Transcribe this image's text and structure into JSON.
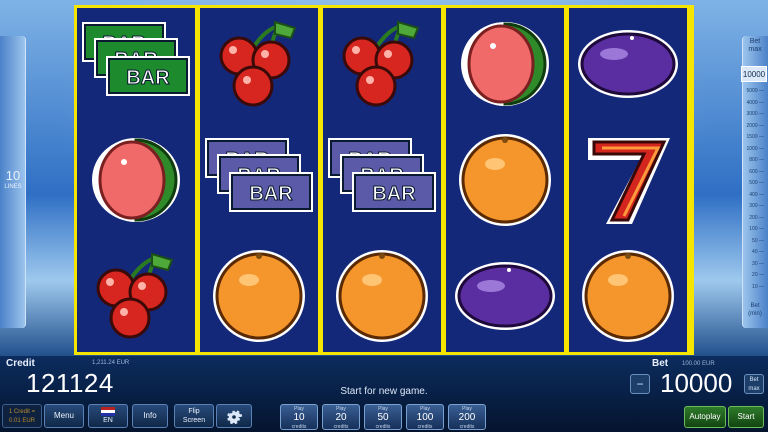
{
  "lines": {
    "value": "10",
    "label": "LINES"
  },
  "bet_scale": {
    "top_label": "Bet",
    "top_max": "max",
    "current": "10000",
    "ticks": [
      "5000",
      "4000",
      "3000",
      "2000",
      "1500",
      "1000",
      "800",
      "600",
      "500",
      "400",
      "300",
      "200",
      "100",
      "50",
      "40",
      "30",
      "20",
      "10"
    ],
    "bottom_label": "Bet",
    "bottom_min": "(min)"
  },
  "reels": [
    [
      "triple-bar-green",
      "watermelon",
      "cherries"
    ],
    [
      "cherries",
      "triple-bar-purple",
      "orange"
    ],
    [
      "cherries",
      "triple-bar-purple",
      "orange"
    ],
    [
      "watermelon",
      "orange",
      "plum"
    ],
    [
      "plum",
      "seven",
      "orange"
    ]
  ],
  "bar_text": "BAR",
  "credit": {
    "label": "Credit",
    "eur": "1,211.24 EUR",
    "value": "121124"
  },
  "message": "Start for new game.",
  "bet": {
    "label": "Bet",
    "eur": "100.00 EUR",
    "value": "10000",
    "max": "Bet max"
  },
  "buttons": {
    "rate_line1": "1 Credit =",
    "rate_line2": "0.01 EUR",
    "menu": "Menu",
    "lang": "EN",
    "info": "Info",
    "flip_line1": "Flip",
    "flip_line2": "Screen",
    "autoplay": "Autoplay",
    "start": "Start"
  },
  "play_buttons": [
    {
      "top": "Play",
      "num": "10",
      "bot": "credits"
    },
    {
      "top": "Play",
      "num": "20",
      "bot": "credits"
    },
    {
      "top": "Play",
      "num": "50",
      "bot": "credits"
    },
    {
      "top": "Play",
      "num": "100",
      "bot": "credits"
    },
    {
      "top": "Play",
      "num": "200",
      "bot": "credits"
    }
  ],
  "colors": {
    "frame": "#f5e500",
    "reel_bg": "#14287a",
    "bar_green": "#1e8a2e",
    "bar_purple": "#5a5aa8"
  }
}
